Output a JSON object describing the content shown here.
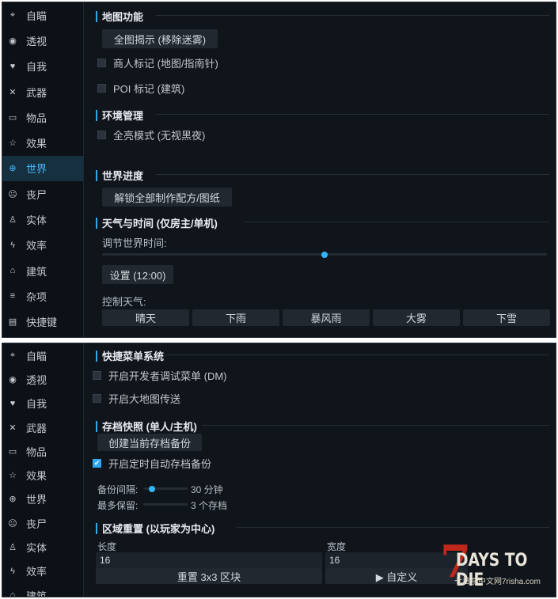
{
  "nav": [
    "自瞄",
    "透视",
    "自我",
    "武器",
    "物品",
    "效果",
    "世界",
    "丧尸",
    "实体",
    "效率",
    "建筑",
    "杂项",
    "快捷键"
  ],
  "nav_bottom": [
    "自瞄",
    "透视",
    "自我",
    "武器",
    "物品",
    "效果",
    "世界",
    "丧尸",
    "实体",
    "效率",
    "建筑"
  ],
  "nav_icons": [
    "crosshair-icon",
    "eye-icon",
    "heart-icon",
    "swords-icon",
    "item-box-icon",
    "star-icon",
    "globe-icon",
    "zombie-icon",
    "person-icon",
    "lightning-icon",
    "home-icon",
    "sliders-icon",
    "keyboard-icon"
  ],
  "top": {
    "map_title": "地图功能",
    "reveal_map": "全图揭示 (移除迷雾)",
    "trader_marker": "商人标记 (地图/指南针)",
    "poi_marker": "POI 标记 (建筑)",
    "env_title": "环境管理",
    "fullbright": "全亮模式 (无视黑夜)",
    "progress_title": "世界进度",
    "unlock_recipes": "解锁全部制作配方/图纸",
    "weather_title": "天气与时间 (仅房主/单机)",
    "time_label": "调节世界时间:",
    "time_value": 0.5,
    "set_time": "设置 (12:00)",
    "weather_label": "控制天气:",
    "weather_buttons": [
      "晴天",
      "下雨",
      "暴风雨",
      "大雾",
      "下雪"
    ]
  },
  "bottom": {
    "menu_title": "快捷菜单系统",
    "dev_menu": "开启开发者调试菜单 (DM)",
    "map_teleport": "开启大地图传送",
    "snapshot_title": "存档快照 (单人/主机)",
    "create_backup": "创建当前存档备份",
    "auto_backup": "开启定时自动存档备份",
    "interval_label": "备份间隔:",
    "interval_value": "30 分钟",
    "interval_fraction": 0.2,
    "keep_label": "最多保留:",
    "keep_value": "3 个存档",
    "reset_title": "区域重置 (以玩家为中心)",
    "length_label": "长度",
    "length_value": "16",
    "width_label": "宽度",
    "width_value": "16",
    "reset_button": "重置 3x3 区块",
    "custom_button": "▶ 自定义"
  },
  "logo": {
    "seven": "7",
    "title": "DAYS TO DIE",
    "subtitle": "七日杀中文网7risha.com"
  },
  "colors": {
    "accent": "#2fa8ef",
    "bg": "#10151c",
    "sidebar": "#0c1117",
    "button": "#222830"
  }
}
